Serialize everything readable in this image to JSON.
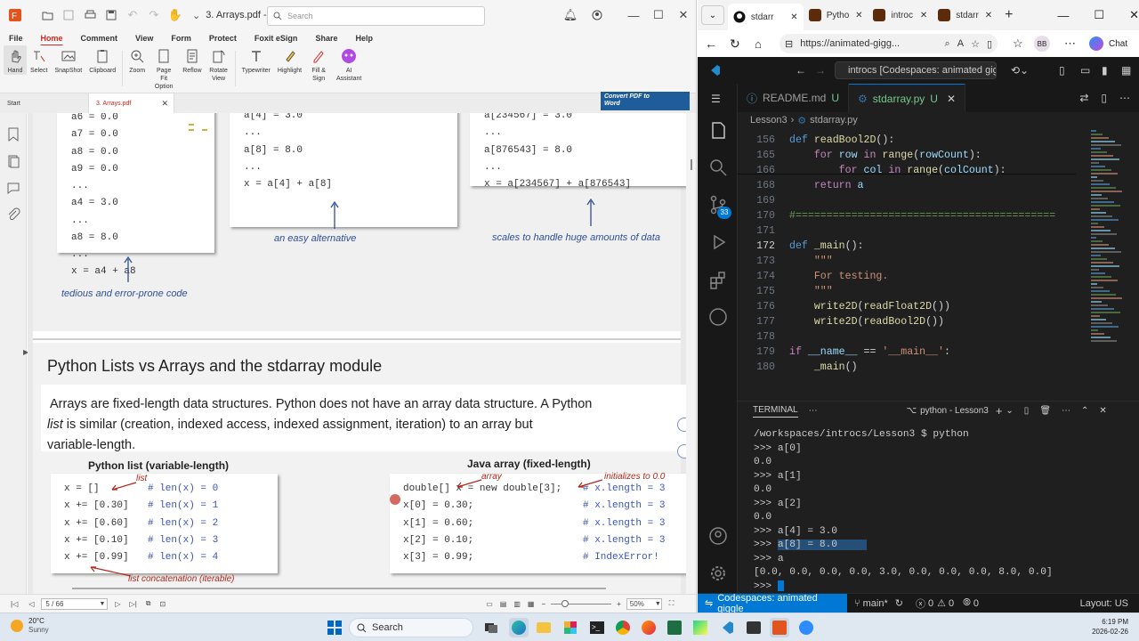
{
  "foxit": {
    "title": "3. Arrays.pdf - Foxit PD...",
    "search_placeholder": "Search",
    "menu": [
      "File",
      "Home",
      "Comment",
      "View",
      "Form",
      "Protect",
      "Foxit eSign",
      "Share",
      "Help"
    ],
    "ribbon": [
      "Hand",
      "Select",
      "SnapShot",
      "Clipboard",
      "Zoom",
      "Page Fit Option",
      "Reflow",
      "Rotate View",
      "Typewriter",
      "Highlight",
      "Fill & Sign",
      "AI Assistant"
    ],
    "tabs": [
      "Start",
      "3. Arrays.pdf"
    ],
    "convert": "Convert PDF to Word",
    "status": {
      "page": "5 / 66",
      "zoom": "50%"
    }
  },
  "slide": {
    "box1": [
      "a6 = 0.0",
      "a7 = 0.0",
      "a8 = 0.0",
      "a9 = 0.0",
      "...",
      "a4 = 3.0",
      "...",
      "a8 = 8.0",
      "...",
      "x = a4 + a8"
    ],
    "box2": [
      "a[4] = 3.0",
      "...",
      "a[8] = 8.0",
      "...",
      "x = a[4] + a[8]"
    ],
    "box3": [
      "a[234567] = 3.0",
      "...",
      "a[876543] = 8.0",
      "...",
      "x = a[234567] + a[876543]"
    ],
    "cap1": "tedious and error-prone code",
    "cap2": "an easy alternative",
    "cap3": "scales to handle huge amounts of data",
    "heading": "Python Lists vs Arrays and the stdarray module",
    "para1": "Arrays are fixed-length data structures.  Python does not have an array data structure.  A Python",
    "para2_italic": "list",
    "para2": " is similar (creation, indexed access, indexed assignment, iteration) to an array but",
    "para3": "variable-length.",
    "list_title": "Python list (variable-length)",
    "array_title": "Java array (fixed-length)",
    "list_label": "list",
    "array_label": "array",
    "init_label": "initializes to 0.0",
    "concat_label": "list concatenation (iterable)",
    "list_code": [
      {
        "code": "x = []",
        "cmt": "# len(x) = 0"
      },
      {
        "code": "x += [0.30]",
        "cmt": "# len(x) = 1"
      },
      {
        "code": "x += [0.60]",
        "cmt": "# len(x) = 2"
      },
      {
        "code": "x += [0.10]",
        "cmt": "# len(x) = 3"
      },
      {
        "code": "x += [0.99]",
        "cmt": "# len(x) = 4"
      }
    ],
    "array_code": [
      {
        "code": "double[] x = new double[3];",
        "cmt": "# x.length = 3"
      },
      {
        "code": "x[0] = 0.30;",
        "cmt": "# x.length = 3"
      },
      {
        "code": "x[1] = 0.60;",
        "cmt": "# x.length = 3"
      },
      {
        "code": "x[2] = 0.10;",
        "cmt": "# x.length = 3"
      },
      {
        "code": "x[3] = 0.99;",
        "cmt": "# IndexError!"
      }
    ]
  },
  "edge": {
    "tabs": [
      "stdarr",
      "Pytho",
      "introc",
      "stdarr"
    ],
    "url": "https://animated-gigg..."
  },
  "vscode": {
    "command_center": "introcs [Codespaces: animated giggl",
    "tabs": [
      {
        "name": "README.md",
        "flag": "U"
      },
      {
        "name": "stdarray.py",
        "flag": "U"
      }
    ],
    "breadcrumb": [
      "Lesson3",
      "stdarray.py"
    ],
    "terminal_tab": "TERMINAL",
    "terminal_name": "python - Lesson3",
    "terminal_lines": [
      "/workspaces/introcs/Lesson3 $ python",
      ">>> a[0]",
      "0.0",
      ">>> a[1]",
      "0.0",
      ">>> a[2]",
      "0.0",
      ">>> a[4] = 3.0",
      ">>> a[8] = 8.0",
      ">>> a",
      "[0.0, 0.0, 0.0, 0.0, 3.0, 0.0, 0.0, 0.0, 8.0, 0.0]",
      ">>> "
    ],
    "status": {
      "remote": "Codespaces: animated giggle",
      "branch": "main*",
      "errors": "0",
      "warnings": "0",
      "ports": "0",
      "layout": "Layout: US"
    },
    "badge": "33"
  },
  "taskbar": {
    "temp": "20°C",
    "weather": "Sunny",
    "search": "Search",
    "time": "6:19 PM",
    "date": "2026-02-26"
  }
}
